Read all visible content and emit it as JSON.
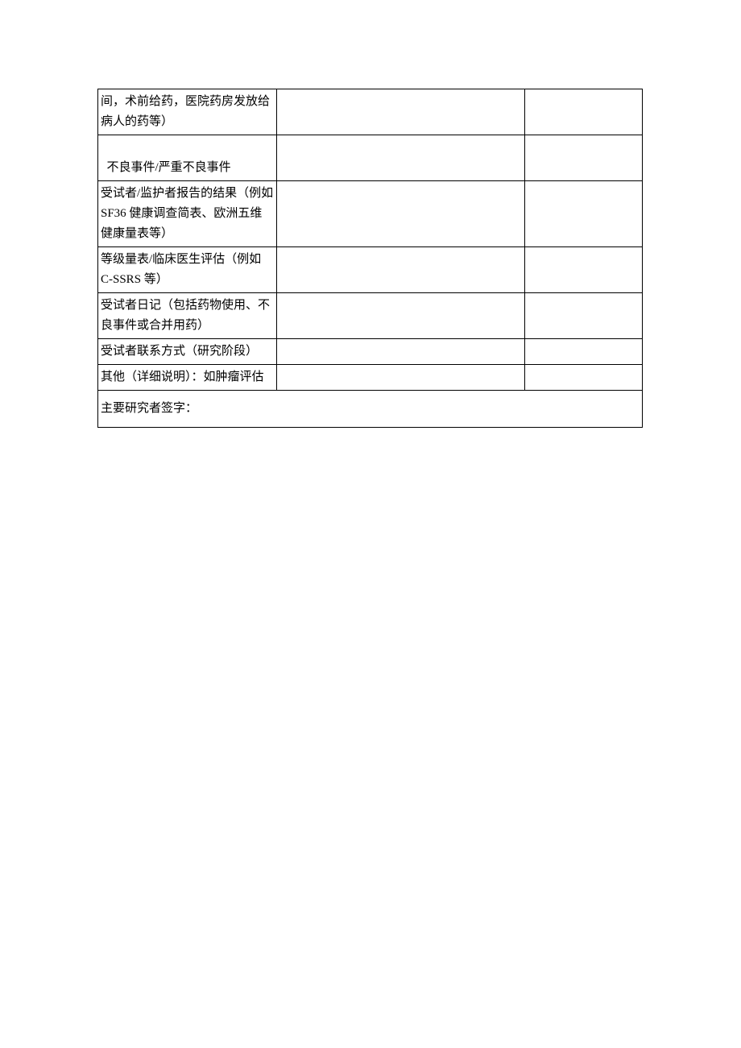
{
  "table": {
    "rows": [
      {
        "c1": "间，术前给药，医院药房发放给病人的药等）",
        "c2": "",
        "c3": ""
      },
      {
        "c1": " \n不良事件/严重不良事件",
        "c2": "",
        "c3": ""
      },
      {
        "c1": "受试者/监护者报告的结果（例如 SF36 健康调查简表、欧洲五维健康量表等）",
        "c2": "",
        "c3": ""
      },
      {
        "c1": "等级量表/临床医生评估（例如 C-SSRS 等）",
        "c2": "",
        "c3": ""
      },
      {
        "c1": "受试者日记（包括药物使用、不良事件或合并用药）",
        "c2": "",
        "c3": ""
      },
      {
        "c1": "受试者联系方式（研究阶段）",
        "c2": "",
        "c3": ""
      },
      {
        "c1": "其他（详细说明）：如肿瘤评估",
        "c2": "",
        "c3": ""
      }
    ],
    "signature_label": "主要研究者签字："
  }
}
